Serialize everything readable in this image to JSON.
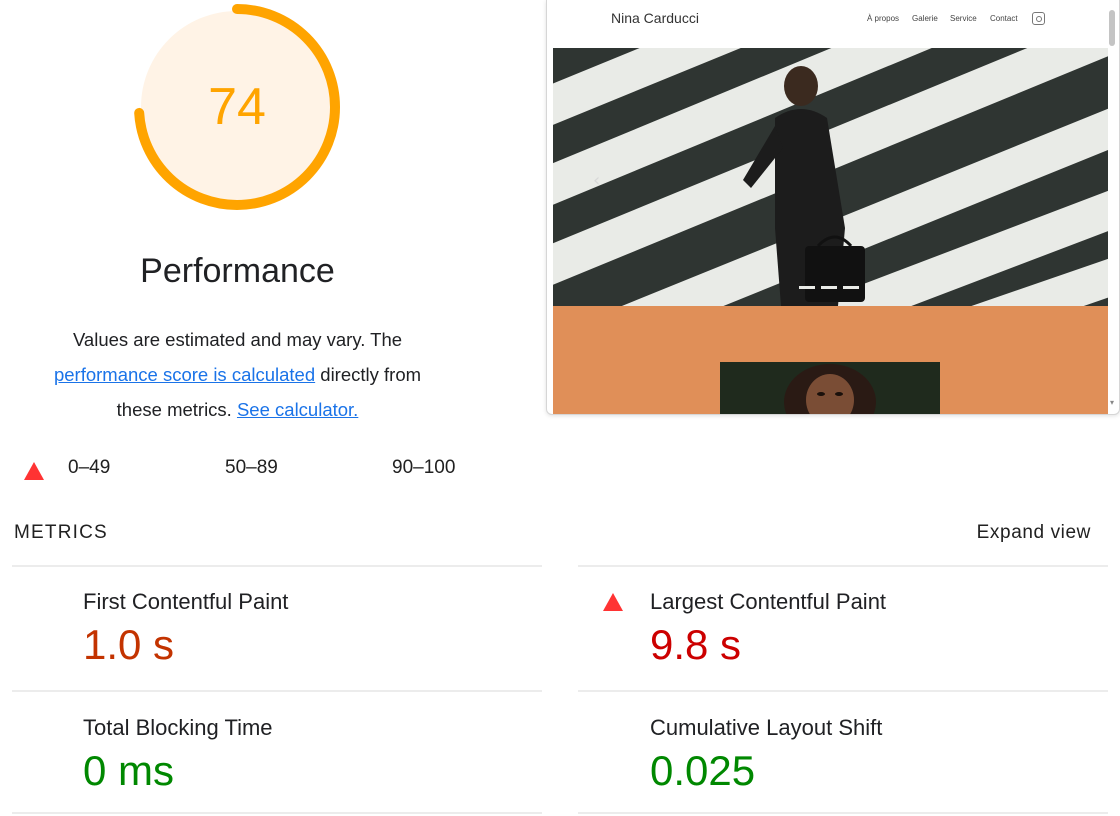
{
  "score": {
    "value": "74",
    "fraction": 0.74,
    "color": "#ffa400",
    "bg": "#fff3e6"
  },
  "performance": {
    "title": "Performance",
    "desc_line1": "Values are estimated and may vary. The",
    "desc_link": "performance score is calculated",
    "desc_after_link": " directly from",
    "desc_line3_prefix": "these metrics. ",
    "calc_link": "See calculator."
  },
  "legend": {
    "fail": "0–49",
    "average": "50–89",
    "pass": "90–100"
  },
  "metrics": {
    "header": "METRICS",
    "expand": "Expand view",
    "items": [
      {
        "name": "First Contentful Paint",
        "value": "1.0 s",
        "color": "#c33300"
      },
      {
        "name": "Largest Contentful Paint",
        "value": "9.8 s",
        "color": "#cc0000"
      },
      {
        "name": "Total Blocking Time",
        "value": "0 ms",
        "color": "#008800"
      },
      {
        "name": "Cumulative Layout Shift",
        "value": "0.025",
        "color": "#008800"
      }
    ]
  },
  "screenshot": {
    "site_name": "Nina Carducci",
    "nav": [
      "À propos",
      "Galerie",
      "Service",
      "Contact"
    ],
    "accent": "#e08f58"
  }
}
